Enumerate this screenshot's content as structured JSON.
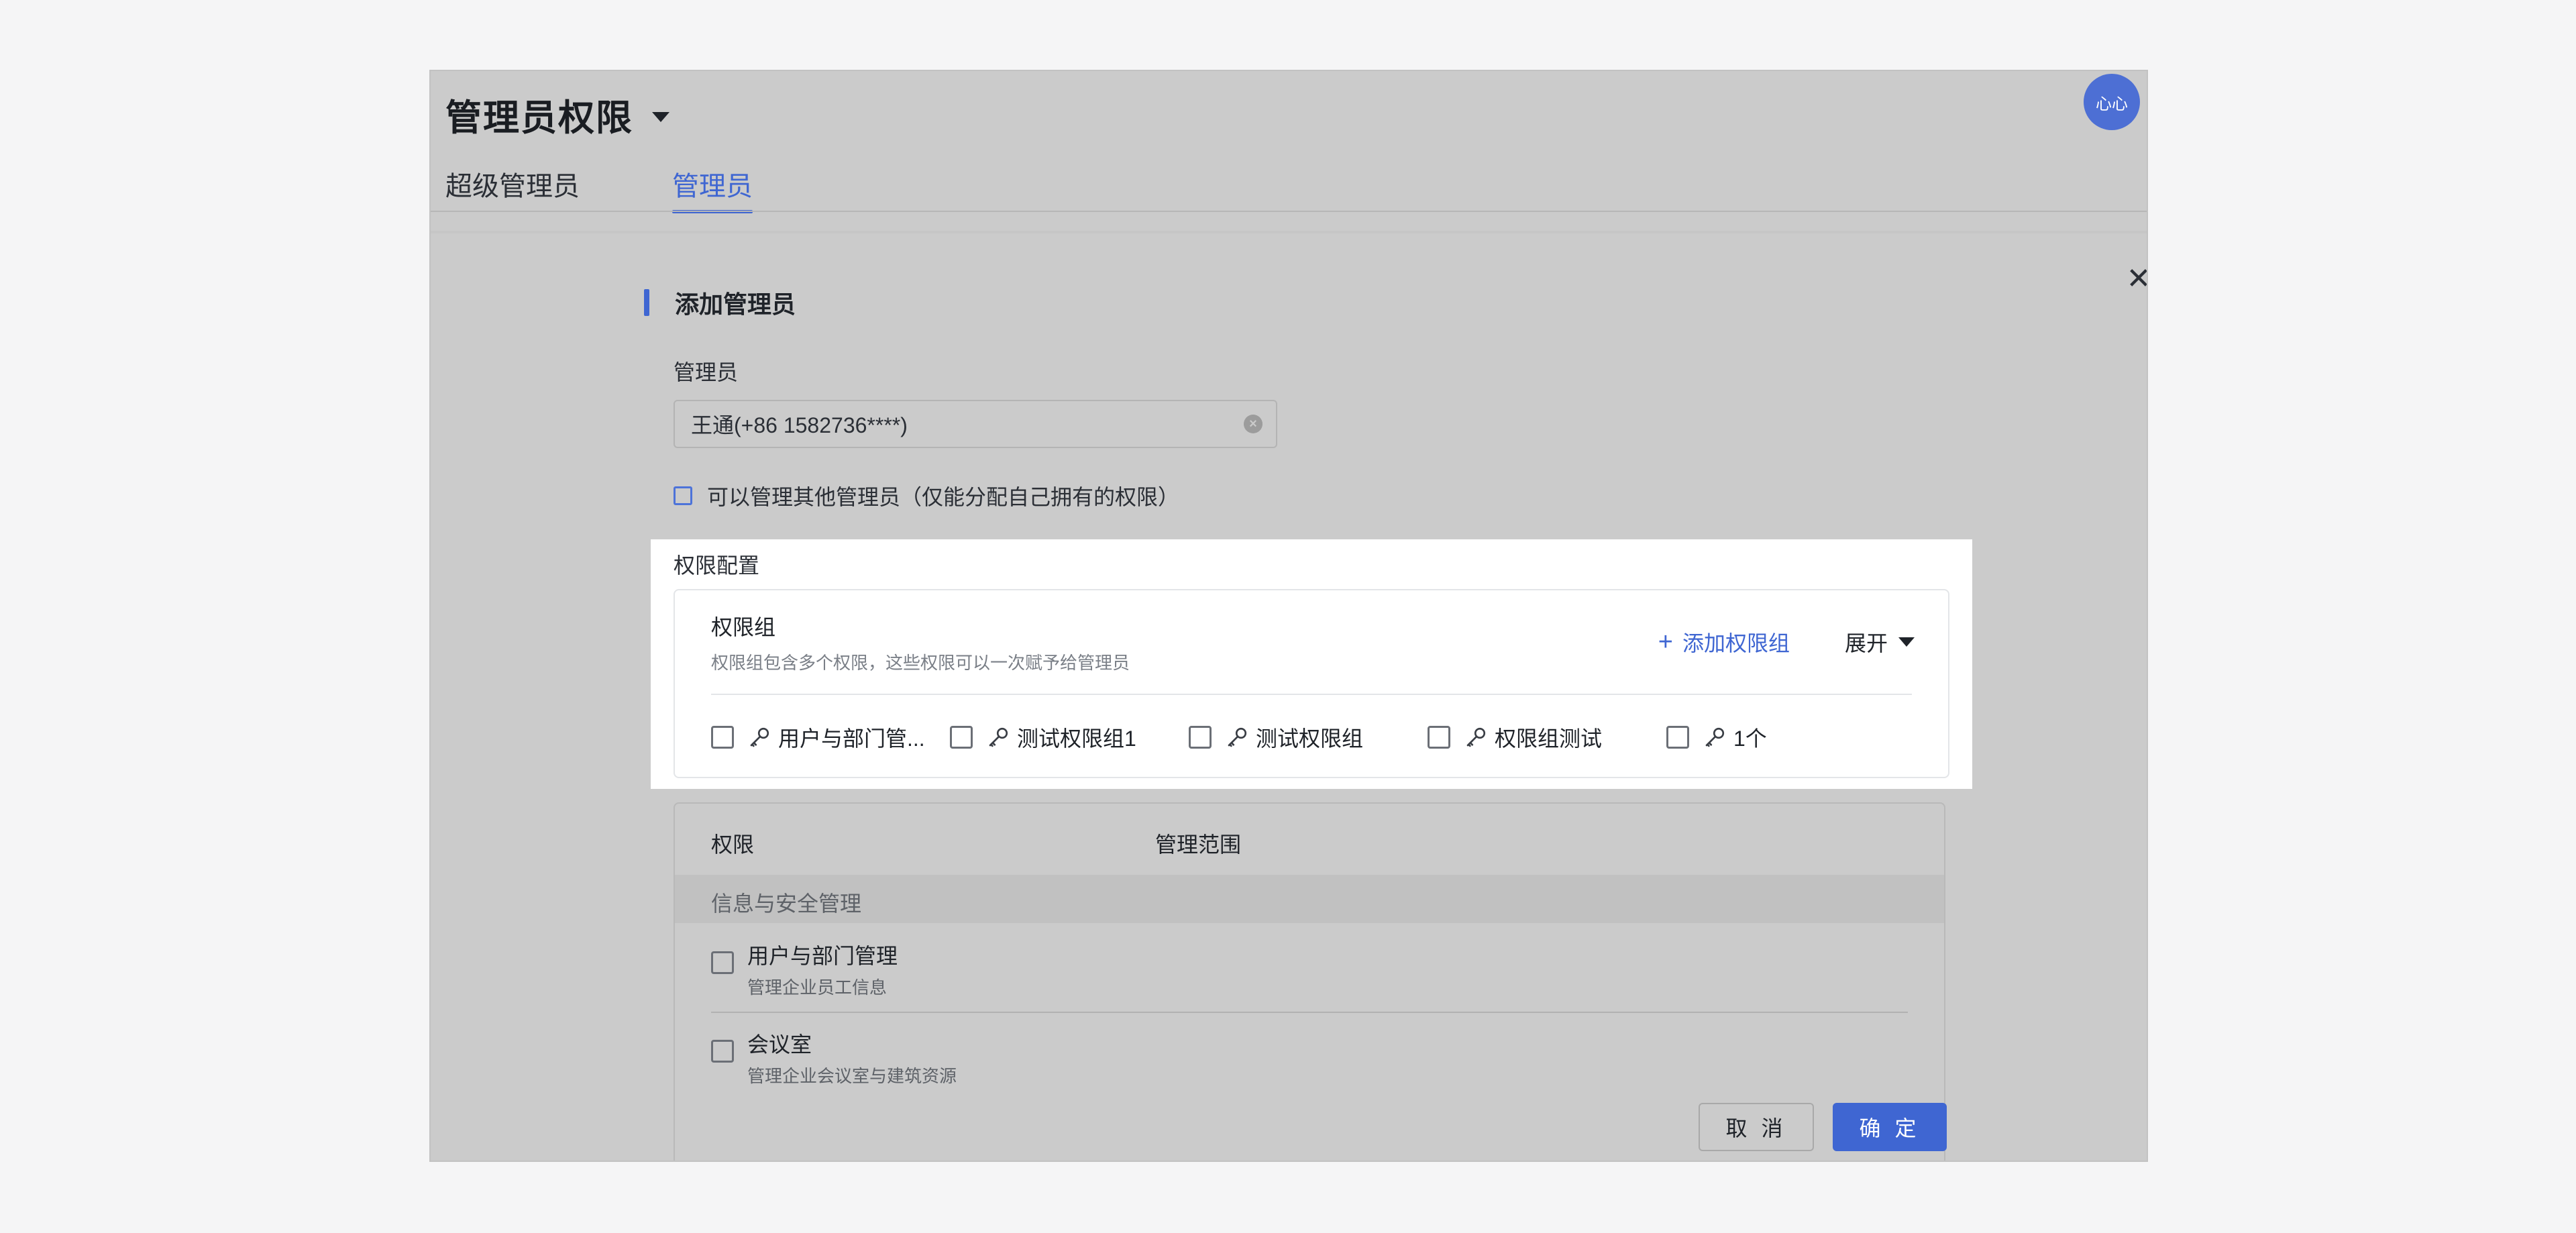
{
  "header": {
    "title": "管理员权限",
    "avatar_text": "心心"
  },
  "tabs": [
    {
      "label": "超级管理员",
      "active": false
    },
    {
      "label": "管理员",
      "active": true
    }
  ],
  "form": {
    "section_title": "添加管理员",
    "admin_label": "管理员",
    "admin_value": "王通(+86 1582736****)",
    "manage_others_label": "可以管理其他管理员（仅能分配自己拥有的权限）",
    "manage_others_checked": false
  },
  "permission_config": {
    "label": "权限配置",
    "group_title": "权限组",
    "group_desc": "权限组包含多个权限，这些权限可以一次赋予给管理员",
    "add_group_label": "添加权限组",
    "expand_label": "展开",
    "groups": [
      {
        "label": "用户与部门管...",
        "checked": false
      },
      {
        "label": "测试权限组1",
        "checked": false
      },
      {
        "label": "测试权限组",
        "checked": false
      },
      {
        "label": "权限组测试",
        "checked": false
      },
      {
        "label": "1个",
        "checked": false
      }
    ]
  },
  "permissions_table": {
    "col_permission": "权限",
    "col_scope": "管理范围",
    "category": "信息与安全管理",
    "rows": [
      {
        "name": "用户与部门管理",
        "desc": "管理企业员工信息",
        "checked": false
      },
      {
        "name": "会议室",
        "desc": "管理企业会议室与建筑资源",
        "checked": false
      }
    ]
  },
  "footer": {
    "cancel_label": "取 消",
    "ok_label": "确 定"
  },
  "colors": {
    "accent": "#3f66d2",
    "overlay": "#cbcbcb",
    "page_bg": "#f5f5f6"
  }
}
